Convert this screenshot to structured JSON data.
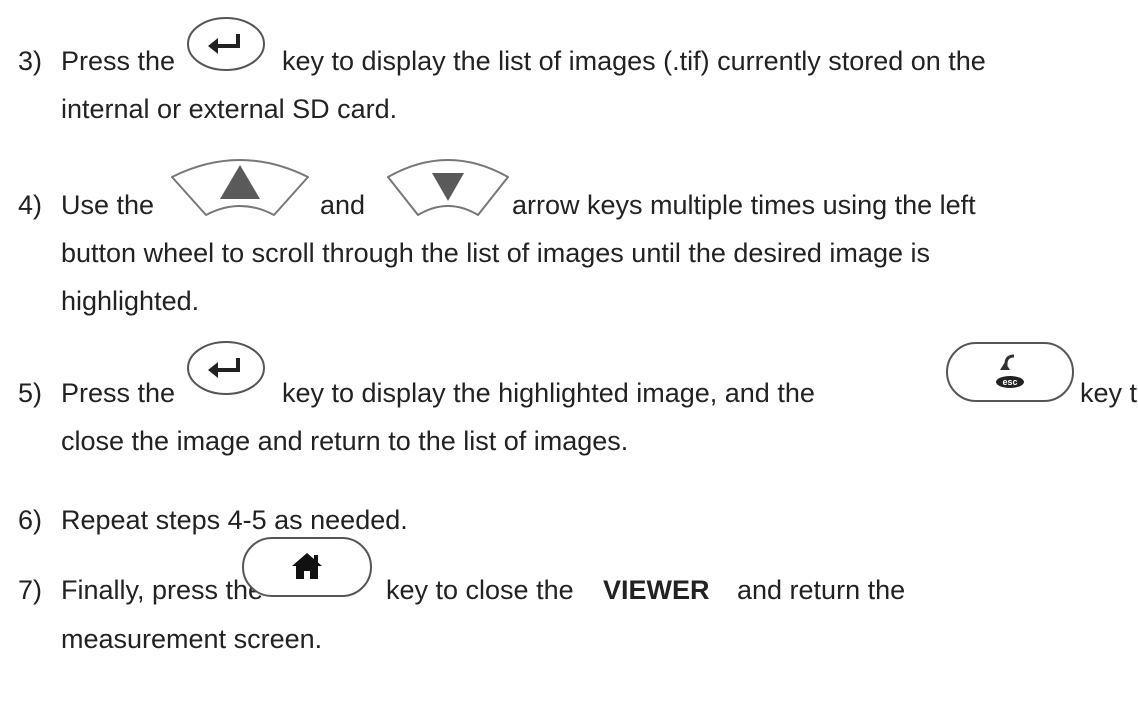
{
  "steps": [
    {
      "number": "3)",
      "line1_a": "Press the",
      "line1_b": "key to display the list of images (.tif) currently stored on the",
      "line2": "internal or external SD card."
    },
    {
      "number": "4)",
      "line1_a": "Use the",
      "line1_b": "and",
      "line1_c": "arrow keys multiple times using the left",
      "line2": "button wheel to scroll through the list of images until the desired image is",
      "line3": "highlighted."
    },
    {
      "number": "5)",
      "line1_a": "Press the",
      "line1_b": "key to display the highlighted image, and the",
      "line1_c": "key to",
      "line2": "close the image and return to the list of images."
    },
    {
      "number": "6)",
      "line1": "Repeat steps 4-5 as needed."
    },
    {
      "number": "7)",
      "line1_a": "Finally, press the",
      "line1_b": "key to close the",
      "line1_bold": "VIEWER",
      "line1_c": "and return the",
      "line2": "measurement screen."
    }
  ],
  "icons": {
    "enter_key": "enter-key-icon",
    "up_arrow_key": "up-arrow-key-icon",
    "down_arrow_key": "down-arrow-key-icon",
    "esc_key": "esc-key-icon",
    "esc_label": "esc",
    "home_key": "home-key-icon"
  }
}
